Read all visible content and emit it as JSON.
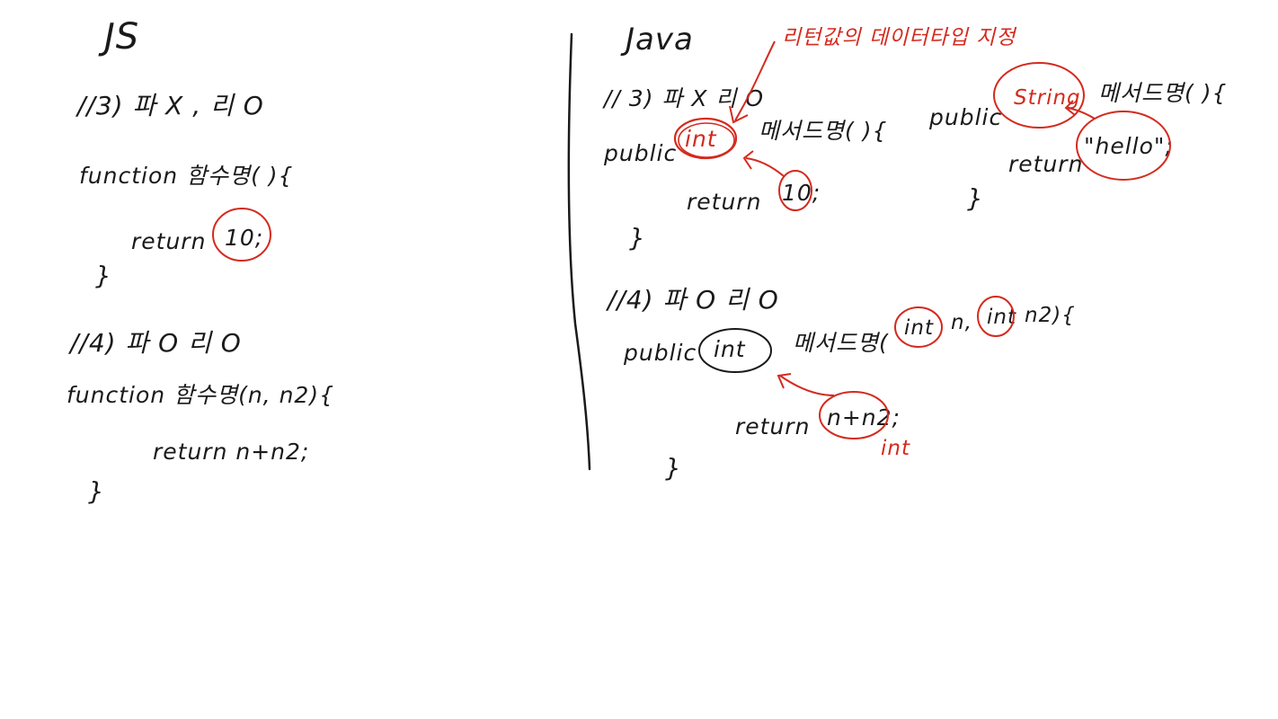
{
  "js": {
    "title": "JS",
    "comment3": "//3) 파 X , 리 O",
    "func1_decl": "function 함수명( ){",
    "func1_return_kw": "return",
    "func1_return_val": "10;",
    "func1_close": "}",
    "comment4": "//4) 파 O 리 O",
    "func2_decl": "function 함수명(n, n2){",
    "func2_return": "return n+n2;",
    "func2_close": "}"
  },
  "java": {
    "title": "Java",
    "annotation": "리턴값의 데이터타입 지정",
    "comment3": "// 3) 파 X 리 O",
    "m1_public": "public",
    "m1_type": "int",
    "m1_name": "메서드명( ){",
    "m1_return_kw": "return",
    "m1_return_val": "10;",
    "m1_close": "}",
    "m2_public": "public",
    "m2_type": "String",
    "m2_name": "메서드명( ){",
    "m2_return_kw": "return",
    "m2_return_val": "\"hello\";",
    "m2_close": "}",
    "comment4": "//4) 파 O 리 O",
    "m3_public": "public",
    "m3_type": "int",
    "m3_name": "메서드명(",
    "m3_param1_type": "int",
    "m3_param1_name": "n,",
    "m3_param2_type": "int",
    "m3_param2_name": "n2){",
    "m3_return_kw": "return",
    "m3_return_val": "n+n2;",
    "m3_return_note": "int",
    "m3_close": "}"
  },
  "colors": {
    "ink": "#1a1a1a",
    "annotation": "#d42a1e",
    "background": "#ffffff"
  }
}
